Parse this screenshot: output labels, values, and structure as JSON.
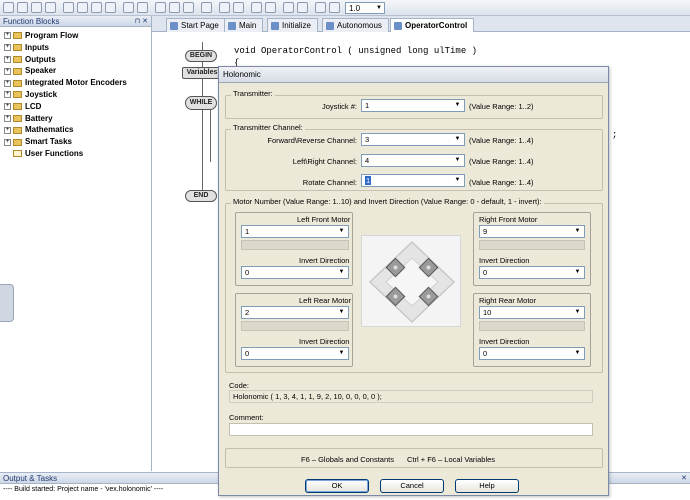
{
  "toolbar": {
    "zoom_value": "1.0"
  },
  "function_blocks": {
    "title": "Function Blocks",
    "items": [
      {
        "label": "Program Flow",
        "expandable": true
      },
      {
        "label": "Inputs",
        "expandable": true
      },
      {
        "label": "Outputs",
        "expandable": true
      },
      {
        "label": "Speaker",
        "expandable": true
      },
      {
        "label": "Integrated Motor Encoders",
        "expandable": true
      },
      {
        "label": "Joystick",
        "expandable": true
      },
      {
        "label": "LCD",
        "expandable": true
      },
      {
        "label": "Battery",
        "expandable": true
      },
      {
        "label": "Mathematics",
        "expandable": true
      },
      {
        "label": "Smart Tasks",
        "expandable": true
      },
      {
        "label": "User Functions",
        "expandable": false
      }
    ]
  },
  "tabs": [
    "Start Page",
    "Main",
    "Initialize",
    "Autonomous",
    "OperatorControl"
  ],
  "active_tab": "OperatorControl",
  "editor": {
    "flow_blocks": [
      "BEGIN",
      "Variables",
      "WHILE",
      "END"
    ],
    "code_line_1": "void OperatorControl ( unsigned long ulTime )",
    "code_line_2": "{",
    "code_line_3": ";"
  },
  "output": {
    "title": "Output & Tasks",
    "line": "---- Build started: Project name - 'vex.holonomic' ----"
  },
  "dialog": {
    "title": "Holonomic",
    "transmitter_label": "Transmitter:",
    "joystick_label": "Joystick #:",
    "joystick_value": "1",
    "joystick_range": "(Value Range: 1..2)",
    "channel_label": "Transmitter Channel:",
    "fr_label": "Forward\\Reverse Channel:",
    "fr_value": "3",
    "fr_range": "(Value Range: 1..4)",
    "lr_label": "Left\\Right Channel:",
    "lr_value": "4",
    "lr_range": "(Value Range: 1..4)",
    "rot_label": "Rotate Channel:",
    "rot_value": "1",
    "rot_range": "(Value Range: 1..4)",
    "motor_header": "Motor Number (Value Range: 1..10)  and  Invert Direction (Value Range: 0 - default, 1 - invert):",
    "motors": {
      "left_front": {
        "title": "Left Front Motor",
        "value": "1",
        "invert_label": "Invert Direction",
        "invert_value": "0"
      },
      "right_front": {
        "title": "Right Front Motor",
        "value": "9",
        "invert_label": "Invert Direction",
        "invert_value": "0"
      },
      "left_rear": {
        "title": "Left Rear Motor",
        "value": "2",
        "invert_label": "Invert Direction",
        "invert_value": "0"
      },
      "right_rear": {
        "title": "Right Rear Motor",
        "value": "10",
        "invert_label": "Invert Direction",
        "invert_value": "0"
      }
    },
    "code_label": "Code:",
    "code_value": "Holonomic ( 1, 3, 4, 1, 1, 9, 2, 10, 0, 0, 0, 0 );",
    "comment_label": "Comment:",
    "comment_value": "",
    "hint_globals": "F6 – Globals and Constants",
    "hint_locals": "Ctrl + F6 – Local Variables",
    "ok_label": "OK",
    "cancel_label": "Cancel",
    "help_label": "Help"
  }
}
